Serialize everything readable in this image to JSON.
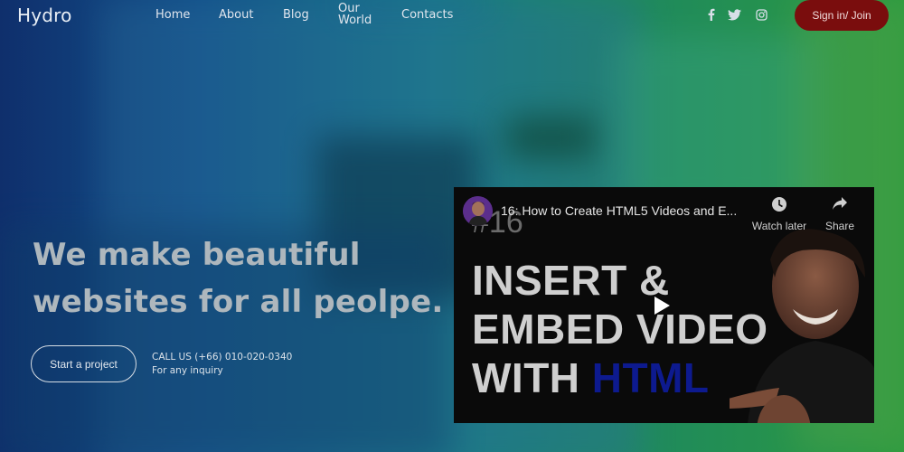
{
  "brand": {
    "logo": "Hydro"
  },
  "nav": {
    "items": [
      "Home",
      "About",
      "Blog",
      "Our World",
      "Contacts"
    ]
  },
  "social": {
    "icons": [
      "facebook-icon",
      "twitter-icon",
      "instagram-icon"
    ]
  },
  "header": {
    "signin_label": "Sign in/ Join"
  },
  "hero": {
    "title_line1": "We make beautiful",
    "title_line2": "websites for all peolpe.",
    "cta_label": "Start a project",
    "call_line1": "CALL US (+66) 010-020-0340",
    "call_line2": "For any inquiry"
  },
  "video": {
    "title": "16: How to Create HTML5 Videos and E...",
    "watch_later": "Watch later",
    "share": "Share",
    "thumb_number": "#16",
    "thumb_line1": "INSERT &",
    "thumb_line2": "EMBED VIDEO",
    "thumb_line3_prefix": "WITH",
    "thumb_line3_highlight": "HTML"
  },
  "colors": {
    "signin_bg": "#7a0d0d",
    "html_highlight": "#0d1a8f"
  }
}
